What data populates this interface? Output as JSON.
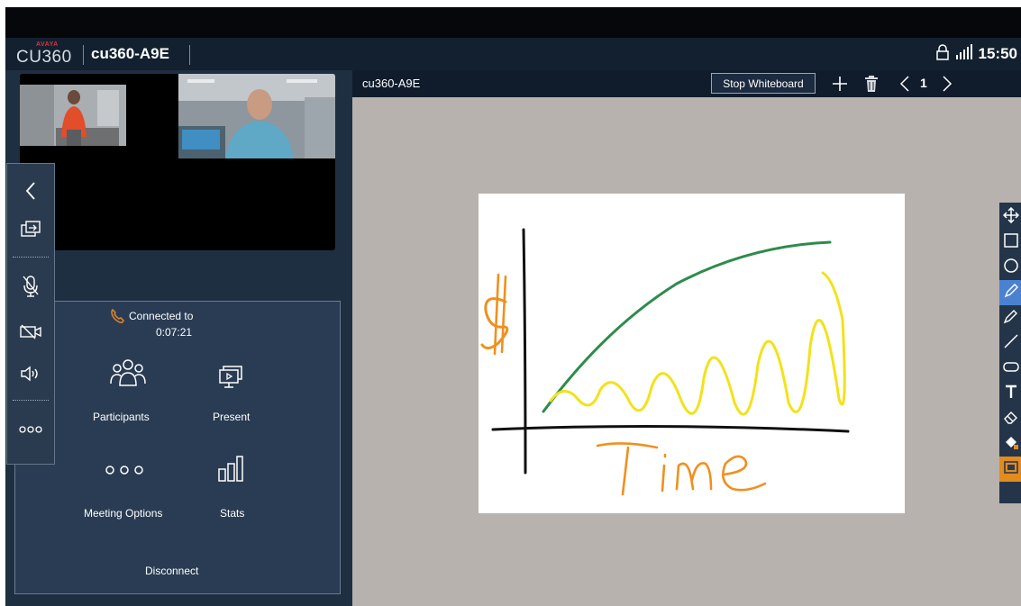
{
  "header": {
    "brand_small": "AVAYA",
    "brand_main": "CU360",
    "device_name": "cu360-A9E",
    "clock": "15:50"
  },
  "call": {
    "connected_label": "Connected to",
    "duration": "0:07:21"
  },
  "controls": {
    "participants": "Participants",
    "present": "Present",
    "meeting_options": "Meeting Options",
    "stats": "Stats",
    "disconnect": "Disconnect"
  },
  "whiteboard": {
    "name": "cu360-A9E",
    "stop_label": "Stop Whiteboard",
    "page": "1"
  },
  "drawing": {
    "x_label": "Time",
    "y_label": "$"
  },
  "colors": {
    "accent_blue": "#4a82d1",
    "accent_orange": "#e38b1e",
    "brand_red": "#d63440",
    "ink_green": "#2e8b4b",
    "ink_yellow": "#f2e21a",
    "ink_orange": "#f0901e"
  },
  "icons": {
    "sidebar": [
      "back-icon",
      "swap-layout-icon",
      "mic-muted-icon",
      "camera-off-icon",
      "speaker-icon",
      "more-icon"
    ],
    "tools": [
      "move-icon",
      "rectangle-icon",
      "circle-icon",
      "pen-icon",
      "marker-icon",
      "line-icon",
      "shape-icon",
      "text-icon",
      "eraser-icon",
      "fill-icon",
      "color-icon"
    ]
  }
}
